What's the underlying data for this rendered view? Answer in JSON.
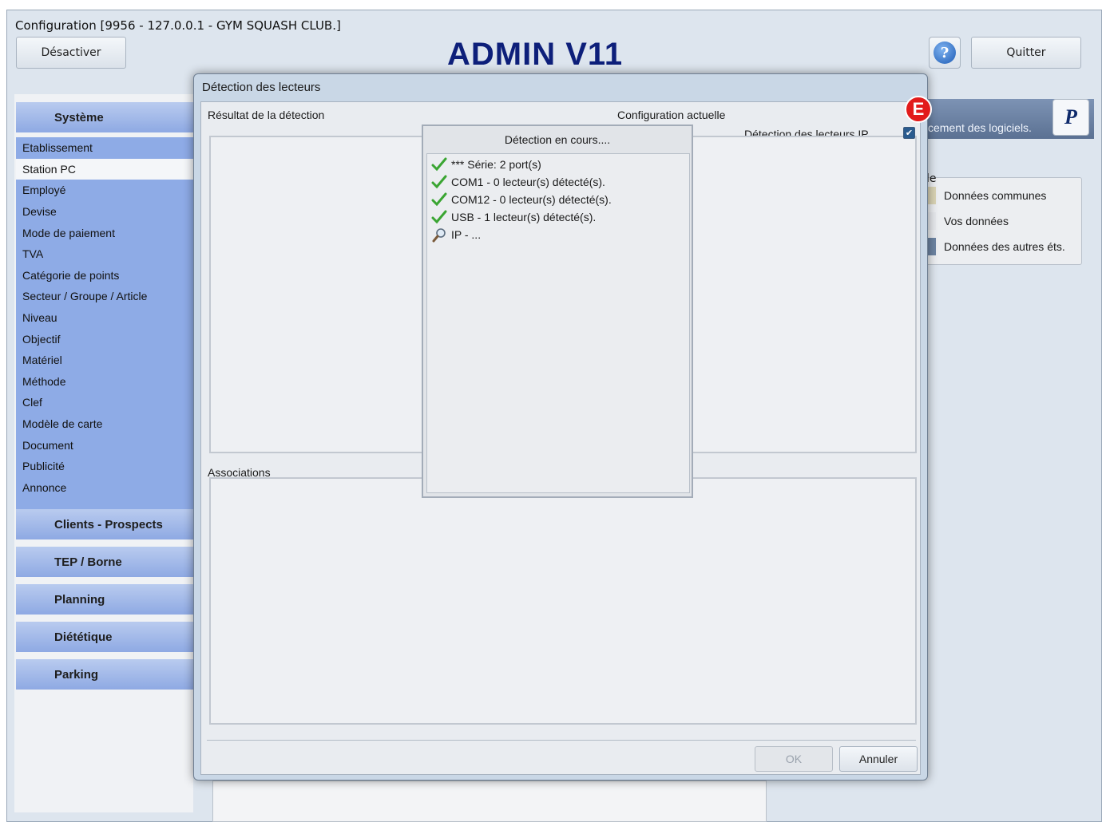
{
  "window": {
    "title": "Configuration [9956 - 127.0.0.1 - GYM SQUASH CLUB.]"
  },
  "toolbar": {
    "deactivate_label": "Désactiver",
    "quit_label": "Quitter",
    "app_heading": "ADMIN V11",
    "help_icon": "help-icon"
  },
  "sidebar": {
    "sections": [
      {
        "label": "Système",
        "items": [
          "Etablissement",
          "Station PC",
          "Employé",
          "Devise",
          "Mode de paiement",
          "TVA",
          "Catégorie de points",
          "Secteur / Groupe / Article",
          "Niveau",
          "Objectif",
          "Matériel",
          "Méthode",
          "Clef",
          "Modèle de carte",
          "Document",
          "Publicité",
          "Annonce"
        ],
        "selected": "Station PC"
      },
      {
        "label": "Clients - Prospects"
      },
      {
        "label": "TEP / Borne"
      },
      {
        "label": "Planning"
      },
      {
        "label": "Diététique"
      },
      {
        "label": "Parking"
      }
    ]
  },
  "right_panel": {
    "banner_text": "cement des logiciels.",
    "logo_letter": "P",
    "legend_fragment": "le",
    "legend": [
      {
        "label": "Données communes",
        "color": "#d9d3b4"
      },
      {
        "label": "Vos données",
        "color": "#e6e8ec"
      },
      {
        "label": "Données des autres éts.",
        "color": "#6d84a3"
      }
    ]
  },
  "dialog": {
    "title": "Détection des lecteurs",
    "result_label": "Résultat de la détection",
    "current_config_label": "Configuration actuelle",
    "ip_detection_label": "Détection des lecteurs IP",
    "ip_detection_checked": true,
    "associations_label": "Associations",
    "ok_label": "OK",
    "cancel_label": "Annuler",
    "badge": "E"
  },
  "progress": {
    "title": "Détection en cours....",
    "items": [
      {
        "icon": "check-icon",
        "text": "*** Série: 2 port(s)"
      },
      {
        "icon": "check-icon",
        "text": "COM1 - 0 lecteur(s) détecté(s)."
      },
      {
        "icon": "check-icon",
        "text": "COM12 - 0 lecteur(s) détecté(s)."
      },
      {
        "icon": "check-icon",
        "text": "USB - 1 lecteur(s) détecté(s)."
      },
      {
        "icon": "magnifier-icon",
        "text": "IP - ..."
      }
    ]
  }
}
